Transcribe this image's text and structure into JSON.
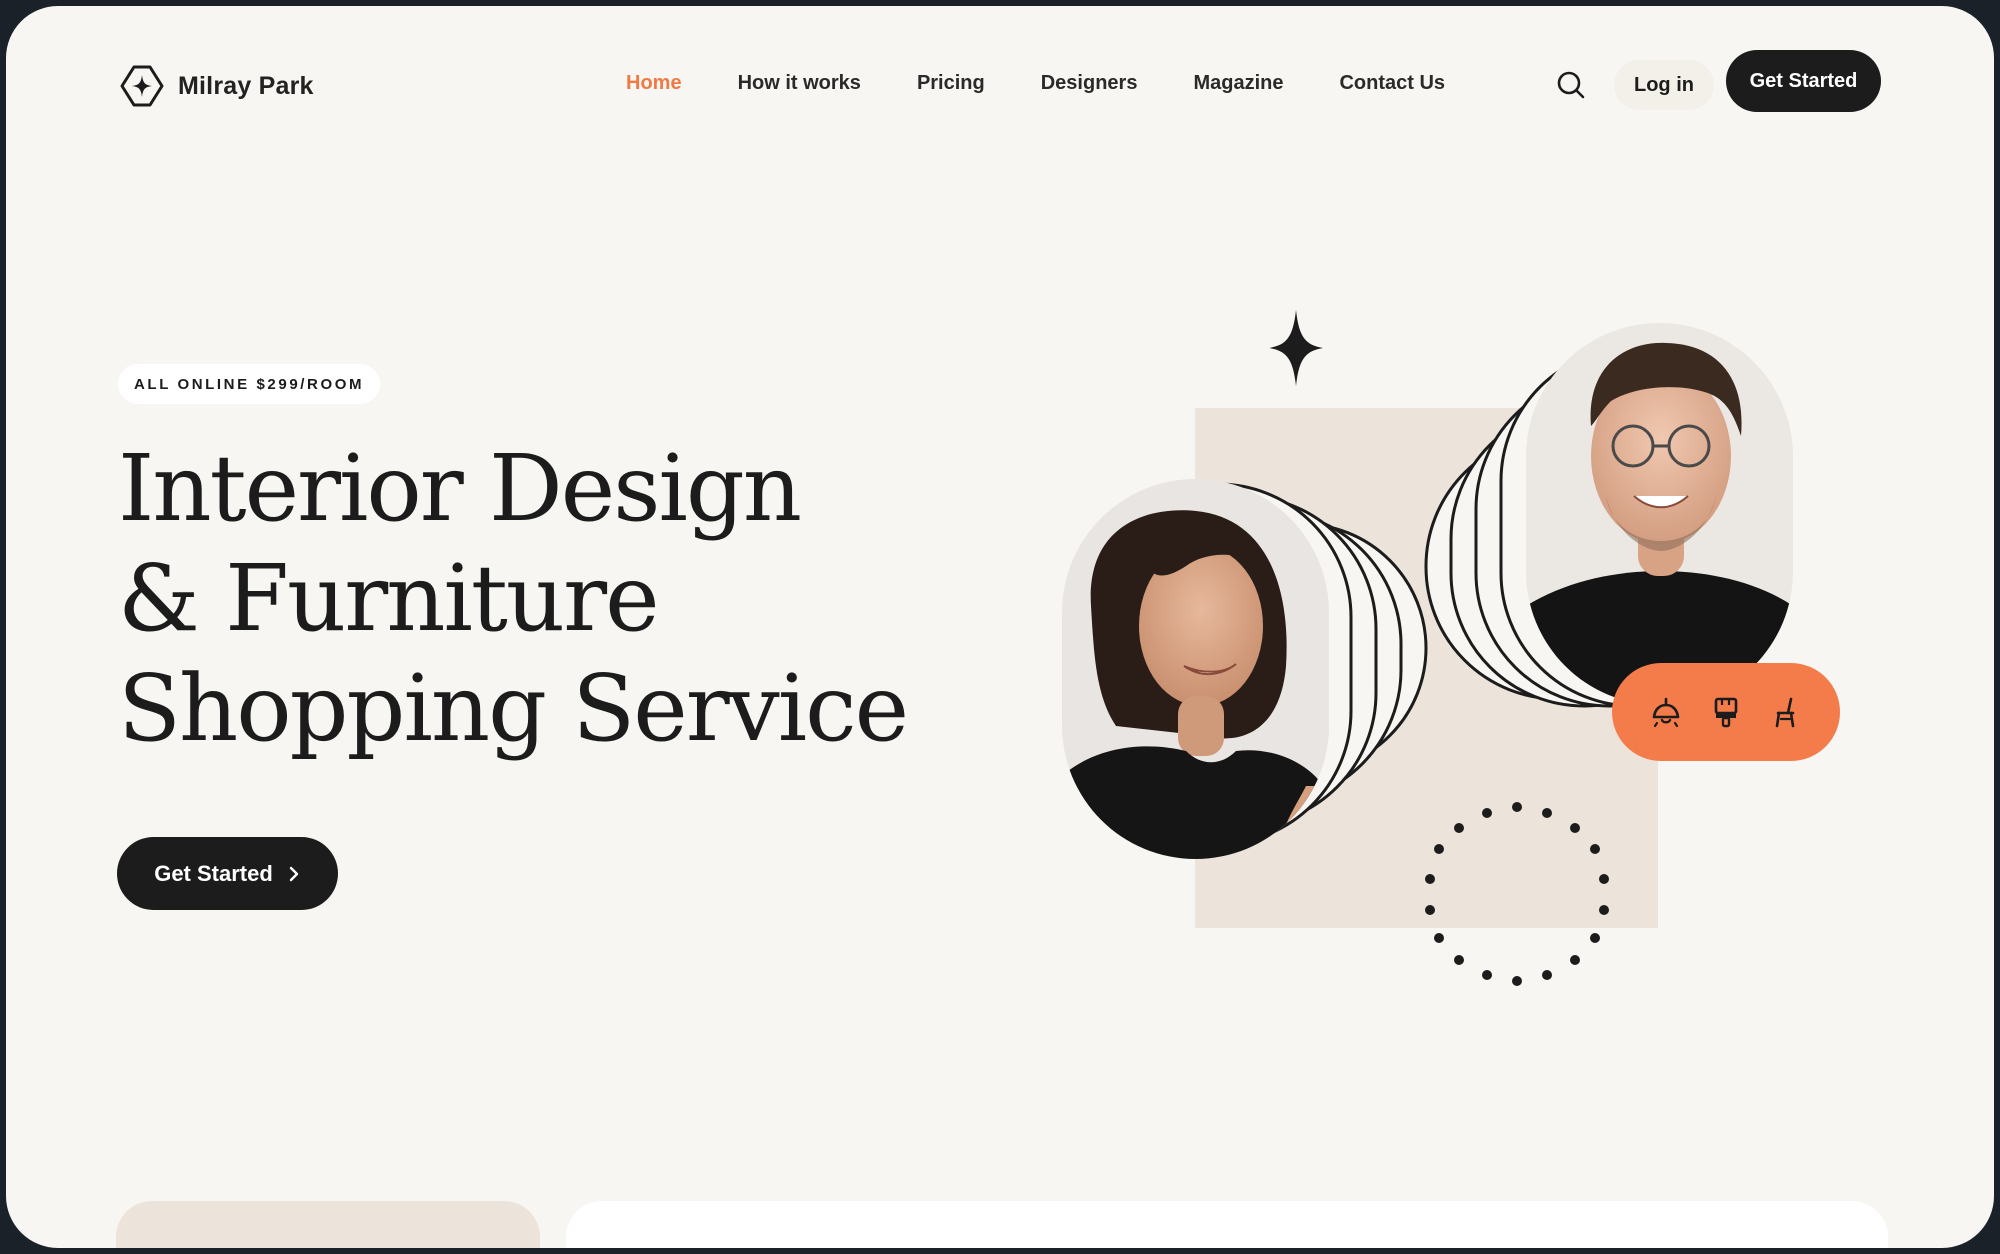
{
  "brand": {
    "name": "Milray Park",
    "logo_icon": "sparkle-hexagon-icon"
  },
  "nav": {
    "items": [
      {
        "label": "Home",
        "active": true
      },
      {
        "label": "How it works",
        "active": false
      },
      {
        "label": "Pricing",
        "active": false
      },
      {
        "label": "Designers",
        "active": false
      },
      {
        "label": "Magazine",
        "active": false
      },
      {
        "label": "Contact Us",
        "active": false
      }
    ],
    "search_icon": "search-icon",
    "login_label": "Log in",
    "cta_label": "Get Started"
  },
  "hero": {
    "badge": "ALL ONLINE $299/ROOM",
    "headline": [
      "Interior Design",
      "& Furniture",
      "Shopping Service"
    ],
    "cta_label": "Get Started",
    "cta_icon": "chevron-right-icon"
  },
  "illustration": {
    "icons": [
      "ceiling-lamp-icon",
      "paint-brush-icon",
      "chair-icon"
    ]
  },
  "colors": {
    "accent": "#f07a45",
    "pill": "#f47b4a",
    "dark": "#1c1c1c",
    "background": "#f8f6f2",
    "beige": "#ece4db"
  }
}
